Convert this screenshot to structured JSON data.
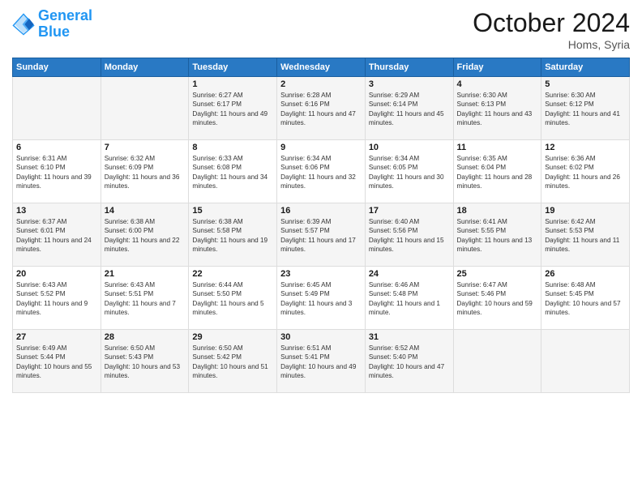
{
  "header": {
    "logo_line1": "General",
    "logo_line2": "Blue",
    "month_title": "October 2024",
    "location": "Homs, Syria"
  },
  "weekdays": [
    "Sunday",
    "Monday",
    "Tuesday",
    "Wednesday",
    "Thursday",
    "Friday",
    "Saturday"
  ],
  "weeks": [
    [
      {
        "day": "",
        "sunrise": "",
        "sunset": "",
        "daylight": ""
      },
      {
        "day": "",
        "sunrise": "",
        "sunset": "",
        "daylight": ""
      },
      {
        "day": "1",
        "sunrise": "Sunrise: 6:27 AM",
        "sunset": "Sunset: 6:17 PM",
        "daylight": "Daylight: 11 hours and 49 minutes."
      },
      {
        "day": "2",
        "sunrise": "Sunrise: 6:28 AM",
        "sunset": "Sunset: 6:16 PM",
        "daylight": "Daylight: 11 hours and 47 minutes."
      },
      {
        "day": "3",
        "sunrise": "Sunrise: 6:29 AM",
        "sunset": "Sunset: 6:14 PM",
        "daylight": "Daylight: 11 hours and 45 minutes."
      },
      {
        "day": "4",
        "sunrise": "Sunrise: 6:30 AM",
        "sunset": "Sunset: 6:13 PM",
        "daylight": "Daylight: 11 hours and 43 minutes."
      },
      {
        "day": "5",
        "sunrise": "Sunrise: 6:30 AM",
        "sunset": "Sunset: 6:12 PM",
        "daylight": "Daylight: 11 hours and 41 minutes."
      }
    ],
    [
      {
        "day": "6",
        "sunrise": "Sunrise: 6:31 AM",
        "sunset": "Sunset: 6:10 PM",
        "daylight": "Daylight: 11 hours and 39 minutes."
      },
      {
        "day": "7",
        "sunrise": "Sunrise: 6:32 AM",
        "sunset": "Sunset: 6:09 PM",
        "daylight": "Daylight: 11 hours and 36 minutes."
      },
      {
        "day": "8",
        "sunrise": "Sunrise: 6:33 AM",
        "sunset": "Sunset: 6:08 PM",
        "daylight": "Daylight: 11 hours and 34 minutes."
      },
      {
        "day": "9",
        "sunrise": "Sunrise: 6:34 AM",
        "sunset": "Sunset: 6:06 PM",
        "daylight": "Daylight: 11 hours and 32 minutes."
      },
      {
        "day": "10",
        "sunrise": "Sunrise: 6:34 AM",
        "sunset": "Sunset: 6:05 PM",
        "daylight": "Daylight: 11 hours and 30 minutes."
      },
      {
        "day": "11",
        "sunrise": "Sunrise: 6:35 AM",
        "sunset": "Sunset: 6:04 PM",
        "daylight": "Daylight: 11 hours and 28 minutes."
      },
      {
        "day": "12",
        "sunrise": "Sunrise: 6:36 AM",
        "sunset": "Sunset: 6:02 PM",
        "daylight": "Daylight: 11 hours and 26 minutes."
      }
    ],
    [
      {
        "day": "13",
        "sunrise": "Sunrise: 6:37 AM",
        "sunset": "Sunset: 6:01 PM",
        "daylight": "Daylight: 11 hours and 24 minutes."
      },
      {
        "day": "14",
        "sunrise": "Sunrise: 6:38 AM",
        "sunset": "Sunset: 6:00 PM",
        "daylight": "Daylight: 11 hours and 22 minutes."
      },
      {
        "day": "15",
        "sunrise": "Sunrise: 6:38 AM",
        "sunset": "Sunset: 5:58 PM",
        "daylight": "Daylight: 11 hours and 19 minutes."
      },
      {
        "day": "16",
        "sunrise": "Sunrise: 6:39 AM",
        "sunset": "Sunset: 5:57 PM",
        "daylight": "Daylight: 11 hours and 17 minutes."
      },
      {
        "day": "17",
        "sunrise": "Sunrise: 6:40 AM",
        "sunset": "Sunset: 5:56 PM",
        "daylight": "Daylight: 11 hours and 15 minutes."
      },
      {
        "day": "18",
        "sunrise": "Sunrise: 6:41 AM",
        "sunset": "Sunset: 5:55 PM",
        "daylight": "Daylight: 11 hours and 13 minutes."
      },
      {
        "day": "19",
        "sunrise": "Sunrise: 6:42 AM",
        "sunset": "Sunset: 5:53 PM",
        "daylight": "Daylight: 11 hours and 11 minutes."
      }
    ],
    [
      {
        "day": "20",
        "sunrise": "Sunrise: 6:43 AM",
        "sunset": "Sunset: 5:52 PM",
        "daylight": "Daylight: 11 hours and 9 minutes."
      },
      {
        "day": "21",
        "sunrise": "Sunrise: 6:43 AM",
        "sunset": "Sunset: 5:51 PM",
        "daylight": "Daylight: 11 hours and 7 minutes."
      },
      {
        "day": "22",
        "sunrise": "Sunrise: 6:44 AM",
        "sunset": "Sunset: 5:50 PM",
        "daylight": "Daylight: 11 hours and 5 minutes."
      },
      {
        "day": "23",
        "sunrise": "Sunrise: 6:45 AM",
        "sunset": "Sunset: 5:49 PM",
        "daylight": "Daylight: 11 hours and 3 minutes."
      },
      {
        "day": "24",
        "sunrise": "Sunrise: 6:46 AM",
        "sunset": "Sunset: 5:48 PM",
        "daylight": "Daylight: 11 hours and 1 minute."
      },
      {
        "day": "25",
        "sunrise": "Sunrise: 6:47 AM",
        "sunset": "Sunset: 5:46 PM",
        "daylight": "Daylight: 10 hours and 59 minutes."
      },
      {
        "day": "26",
        "sunrise": "Sunrise: 6:48 AM",
        "sunset": "Sunset: 5:45 PM",
        "daylight": "Daylight: 10 hours and 57 minutes."
      }
    ],
    [
      {
        "day": "27",
        "sunrise": "Sunrise: 6:49 AM",
        "sunset": "Sunset: 5:44 PM",
        "daylight": "Daylight: 10 hours and 55 minutes."
      },
      {
        "day": "28",
        "sunrise": "Sunrise: 6:50 AM",
        "sunset": "Sunset: 5:43 PM",
        "daylight": "Daylight: 10 hours and 53 minutes."
      },
      {
        "day": "29",
        "sunrise": "Sunrise: 6:50 AM",
        "sunset": "Sunset: 5:42 PM",
        "daylight": "Daylight: 10 hours and 51 minutes."
      },
      {
        "day": "30",
        "sunrise": "Sunrise: 6:51 AM",
        "sunset": "Sunset: 5:41 PM",
        "daylight": "Daylight: 10 hours and 49 minutes."
      },
      {
        "day": "31",
        "sunrise": "Sunrise: 6:52 AM",
        "sunset": "Sunset: 5:40 PM",
        "daylight": "Daylight: 10 hours and 47 minutes."
      },
      {
        "day": "",
        "sunrise": "",
        "sunset": "",
        "daylight": ""
      },
      {
        "day": "",
        "sunrise": "",
        "sunset": "",
        "daylight": ""
      }
    ]
  ]
}
